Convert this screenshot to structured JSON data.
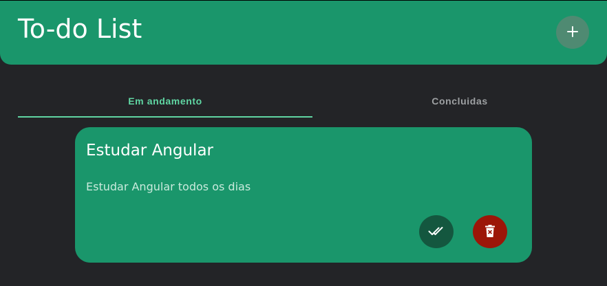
{
  "header": {
    "title": "To-do List",
    "add_icon": "plus-icon"
  },
  "tabs": [
    {
      "label": "Em andamento",
      "active": true
    },
    {
      "label": "Concluidas",
      "active": false
    }
  ],
  "tasks": [
    {
      "title": "Estudar Angular",
      "description": "Estudar Angular todos os dias",
      "complete_icon": "double-check-icon",
      "delete_icon": "trash-icon"
    }
  ],
  "colors": {
    "background": "#232427",
    "header": "#1a966b",
    "card": "#1a966b",
    "accent": "#60d6a3",
    "complete_button": "#14573f",
    "delete_button": "#9c1608"
  }
}
